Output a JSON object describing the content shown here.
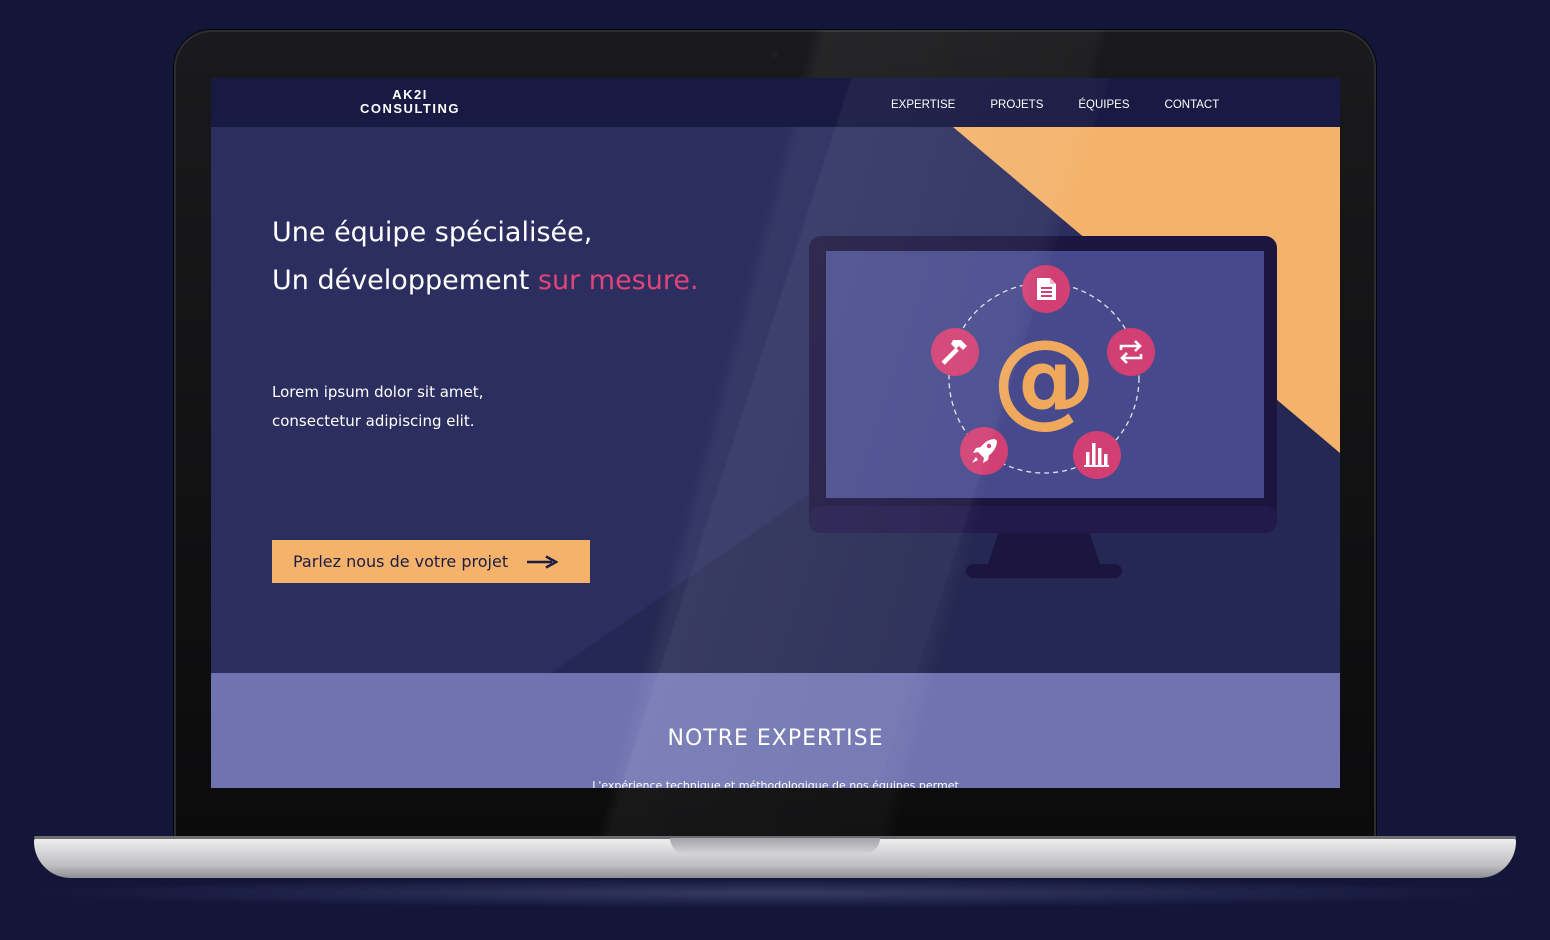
{
  "nav": {
    "logo_line1": "AK2I",
    "logo_line2": "CONSULTING",
    "links": [
      "EXPERTISE",
      "PROJETS",
      "ÉQUIPES",
      "CONTACT"
    ]
  },
  "hero": {
    "headline_line1": "Une équipe spécialisée,",
    "headline_line2_main": "Un développement ",
    "headline_line2_accent": "sur mesure.",
    "lead_line1": "Lorem ipsum dolor sit amet,",
    "lead_line2": "consectetur adipiscing elit.",
    "cta_label": "Parlez nous de votre projet",
    "illustration_center": "@"
  },
  "expertise": {
    "title": "NOTRE EXPERTISE",
    "subtitle": "L'expérience technique et méthodologique de nos équipes permet"
  },
  "colors": {
    "page_background": "#131539",
    "nav_background": "#181a43",
    "hero_background": "#2b2e5e",
    "accent_pink": "#e0457a",
    "accent_orange": "#f4b26a",
    "expertise_background": "#6f74b1"
  },
  "icons": [
    "document-icon",
    "exchange-icon",
    "bar-chart-icon",
    "rocket-icon",
    "hammer-icon",
    "arrow-right-icon"
  ]
}
